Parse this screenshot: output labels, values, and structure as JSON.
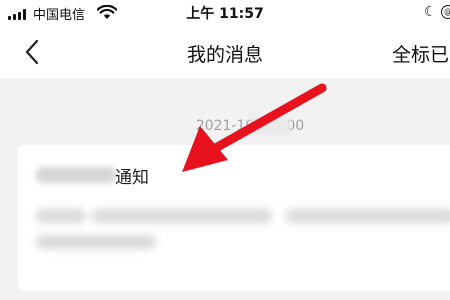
{
  "status_bar": {
    "carrier": "中国电信",
    "time": "上午 11:57"
  },
  "nav": {
    "title": "我的消息",
    "right_action": "全标已"
  },
  "message": {
    "timestamp": "2021-10-   12:00",
    "title": "通知"
  },
  "colors": {
    "annotation_arrow": "#e8121e"
  }
}
